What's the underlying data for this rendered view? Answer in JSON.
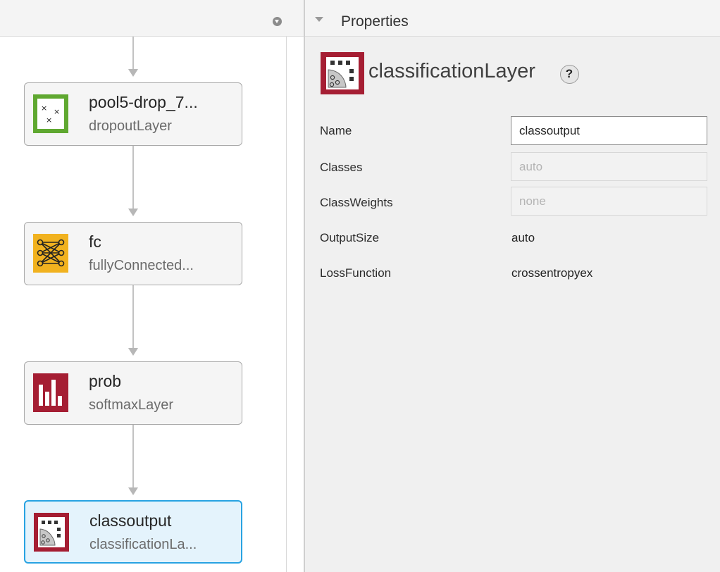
{
  "graph": {
    "nodes": [
      {
        "name": "pool5-drop_7...",
        "type": "dropoutLayer",
        "icon": "dropout-layer-icon",
        "color": "#5fa830"
      },
      {
        "name": "fc",
        "type": "fullyConnected...",
        "icon": "fully-connected-layer-icon",
        "color": "#f1b21f"
      },
      {
        "name": "prob",
        "type": "softmaxLayer",
        "icon": "softmax-layer-icon",
        "color": "#a51e33"
      },
      {
        "name": "classoutput",
        "type": "classificationLa...",
        "icon": "classification-layer-icon",
        "color": "#a51e33",
        "selected": true
      }
    ]
  },
  "properties": {
    "header": "Properties",
    "layer_type": "classificationLayer",
    "help_symbol": "?",
    "fields": [
      {
        "label": "Name",
        "value": "classoutput",
        "kind": "input"
      },
      {
        "label": "Classes",
        "value": "auto",
        "kind": "disabled-input"
      },
      {
        "label": "ClassWeights",
        "value": "none",
        "kind": "disabled-input"
      },
      {
        "label": "OutputSize",
        "value": "auto",
        "kind": "text"
      },
      {
        "label": "LossFunction",
        "value": "crossentropyex",
        "kind": "text"
      }
    ]
  },
  "colors": {
    "selection_border": "#28a3e2",
    "selection_fill": "#e4f3fc",
    "classification_red": "#a51e33"
  }
}
